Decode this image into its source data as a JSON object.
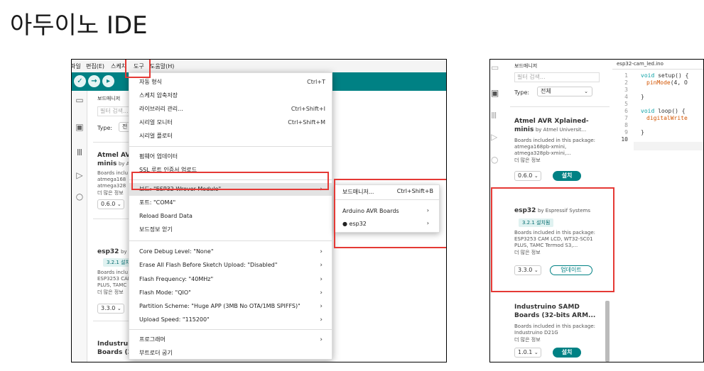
{
  "title": "아두이노 IDE",
  "left": {
    "menubar": [
      "파일",
      "편집(E)",
      "스케치",
      "도구",
      "도움말(H)"
    ],
    "panel": {
      "header": "보드매니저",
      "filter_placeholder": "필터 검색...",
      "type_label": "Type:",
      "type_value": "전",
      "card1_title": "Atmel AVR",
      "card1_title2": "minis",
      "card1_by": "by At",
      "card1_desc1": "Boards inclu",
      "card1_desc2": "atmega168",
      "card1_desc3": "atmega328",
      "card1_more": "더 많은 정보",
      "card1_version": "0.6.0",
      "card2_title": "esp32",
      "card2_by": "by E",
      "card2_badge": "3.2.1 설치됨",
      "card2_desc1": "Boards inclu",
      "card2_desc2": "ESP3253 CAM",
      "card2_desc3": "PLUS, TAMC",
      "card2_more": "더 많은 정보",
      "card2_version": "3.3.0",
      "card3_title": "Industruir",
      "card3_title2": "Boards (32"
    },
    "menu": {
      "items": [
        {
          "label": "자동 형식",
          "shortcut": "Ctrl+T"
        },
        {
          "label": "스케치 압축저장",
          "shortcut": ""
        },
        {
          "label": "라이브러리 관리...",
          "shortcut": "Ctrl+Shift+I"
        },
        {
          "label": "시리얼 모니터",
          "shortcut": "Ctrl+Shift+M"
        },
        {
          "label": "시리얼 플로터",
          "shortcut": ""
        },
        {
          "label": "펌웨어 업데이터",
          "shortcut": ""
        },
        {
          "label": "SSL 루트 인증서 업로드",
          "shortcut": ""
        },
        {
          "label": "보드: \"ESP32 Wrover Module\"",
          "shortcut": ""
        },
        {
          "label": "포트: \"COM4\"",
          "shortcut": ""
        },
        {
          "label": "Reload Board Data",
          "shortcut": ""
        },
        {
          "label": "보드정보 얻기",
          "shortcut": ""
        },
        {
          "label": "Core Debug Level: \"None\"",
          "shortcut": ""
        },
        {
          "label": "Erase All Flash Before Sketch Upload: \"Disabled\"",
          "shortcut": ""
        },
        {
          "label": "Flash Frequency: \"40MHz\"",
          "shortcut": ""
        },
        {
          "label": "Flash Mode: \"QIO\"",
          "shortcut": ""
        },
        {
          "label": "Partition Scheme: \"Huge APP (3MB No OTA/1MB SPIFFS)\"",
          "shortcut": ""
        },
        {
          "label": "Upload Speed: \"115200\"",
          "shortcut": ""
        },
        {
          "label": "프로그래머",
          "shortcut": ""
        },
        {
          "label": "부트로더 굽기",
          "shortcut": ""
        }
      ],
      "arrow": "›"
    },
    "submenu": {
      "board_manager": "보드매니저...",
      "board_manager_shortcut": "Ctrl+Shift+B",
      "avr": "Arduino AVR Boards",
      "esp32": "● esp32"
    }
  },
  "right": {
    "panel": {
      "header": "보드매니저",
      "filter_placeholder": "필터 검색...",
      "type_label": "Type:",
      "type_value": "전체",
      "card1_title": "Atmel AVR Xplained-",
      "card1_title2": "minis",
      "card1_by": "by Atmel Universit...",
      "card1_desc1": "Boards included in this package:",
      "card1_desc2": "atmega168pb-xmini,",
      "card1_desc3": "atmega328pb-xmini,...",
      "card1_more": "더 많은 정보",
      "card1_version": "0.6.0",
      "install": "설치",
      "card2_title": "esp32",
      "card2_by": "by Espressif Systems",
      "card2_badge": "3.2.1 설치됨",
      "card2_desc1": "Boards included in this package:",
      "card2_desc2": "ESP3253 CAM LCD, WT32-SC01",
      "card2_desc3": "PLUS, TAMC Termod S3,...",
      "card2_more": "더 많은 정보",
      "card2_version": "3.3.0",
      "update": "업데이트",
      "card3_title": "Industruino SAMD",
      "card3_title2": "Boards (32-bits ARM...",
      "card3_desc1": "Boards included in this package:",
      "card3_desc2": "Industruino D21G",
      "card3_more": "더 많은 정보",
      "card3_version": "1.0.1"
    },
    "editor": {
      "filename": "esp32-cam_led.ino",
      "line_numbers": [
        "1",
        "2",
        "3",
        "4",
        "5",
        "6",
        "7",
        "8",
        "9",
        "10"
      ],
      "l1_kw": "void",
      "l1_rest": " setup() {",
      "l2_fn": "pinMode",
      "l2_rest": "(4, O",
      "l4": "}",
      "l6_kw": "void",
      "l6_rest": " loop() {",
      "l7_fn": "digitalWrite",
      "l9": "}"
    }
  },
  "colors": {
    "accent": "#008184",
    "highlight": "#e53935"
  }
}
